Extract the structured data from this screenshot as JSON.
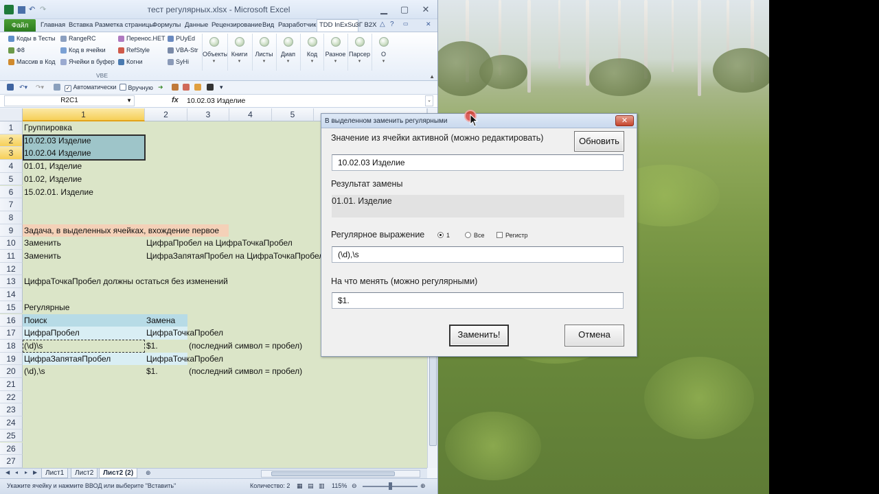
{
  "window": {
    "title": "тест регулярных.xlsx - Microsoft Excel"
  },
  "ribbon_tabs": [
    "Главная",
    "Вставка",
    "Разметка страницы",
    "Формулы",
    "Данные",
    "Рецензирование",
    "Вид",
    "Разработчик",
    "TDD InExSu",
    "ЗГ В2Х"
  ],
  "file_tab": "Файл",
  "ribbon": {
    "col1": [
      "Коды в Тесты",
      "Ф8",
      "Массив в Код"
    ],
    "col2": [
      "RangeRC",
      "Код в ячейки",
      "Ячейки в буфер"
    ],
    "col3": [
      "Перенос.НЕТ",
      "RefStyle",
      "Когни"
    ],
    "col4": [
      "PUyEd",
      "VBA-Str",
      "SyHi"
    ],
    "group_label": "VBE",
    "big_buttons": [
      "Объекты",
      "Книги",
      "Листы",
      "Диап",
      "Код",
      "Разное",
      "Парсер",
      "О"
    ]
  },
  "qat": {
    "auto": "Автоматически",
    "manual": "Вручную"
  },
  "formula_bar": {
    "name_box": "R2C1",
    "fx": "fx",
    "value": "10.02.03  Изделие"
  },
  "columns": [
    "1",
    "2",
    "3",
    "4",
    "5"
  ],
  "rows": [
    {
      "n": "1",
      "a": "Группировка",
      "b": "",
      "c": ""
    },
    {
      "n": "2",
      "a": "10.02.03  Изделие",
      "b": "",
      "c": ""
    },
    {
      "n": "3",
      "a": "10.02.04  Изделие",
      "b": "",
      "c": ""
    },
    {
      "n": "4",
      "a": "01.01, Изделие",
      "b": "",
      "c": ""
    },
    {
      "n": "5",
      "a": "01.02, Изделие",
      "b": "",
      "c": ""
    },
    {
      "n": "6",
      "a": "15.02.01. Изделие",
      "b": "",
      "c": ""
    },
    {
      "n": "7",
      "a": "",
      "b": "",
      "c": ""
    },
    {
      "n": "8",
      "a": "",
      "b": "",
      "c": ""
    },
    {
      "n": "9",
      "a": "Задача, в выделенных ячейках, вхождение первое",
      "b": "",
      "c": ""
    },
    {
      "n": "10",
      "a": "Заменить",
      "b": "ЦифраПробел на ЦифраТочкаПробел",
      "c": ""
    },
    {
      "n": "11",
      "a": "Заменить",
      "b": "ЦифраЗапятаяПробел на ЦифраТочкаПробел",
      "c": ""
    },
    {
      "n": "12",
      "a": "",
      "b": "",
      "c": ""
    },
    {
      "n": "13",
      "a": "ЦифраТочкаПробел должны остаться без изменений",
      "b": "",
      "c": ""
    },
    {
      "n": "14",
      "a": "",
      "b": "",
      "c": ""
    },
    {
      "n": "15",
      "a": "Регулярные",
      "b": "",
      "c": ""
    },
    {
      "n": "16",
      "a": "Поиск",
      "b": "Замена",
      "c": ""
    },
    {
      "n": "17",
      "a": "ЦифраПробел",
      "b": "ЦифраТочкаПробел",
      "c": ""
    },
    {
      "n": "18",
      "a": "(\\d)\\s",
      "b": "$1.",
      "c": "(последний символ = пробел)"
    },
    {
      "n": "19",
      "a": "ЦифраЗапятаяПробел",
      "b": "ЦифраТочкаПробел",
      "c": ""
    },
    {
      "n": "20",
      "a": "(\\d),\\s",
      "b": "$1.",
      "c": "(последний символ = пробел)"
    },
    {
      "n": "21",
      "a": "",
      "b": "",
      "c": ""
    },
    {
      "n": "22",
      "a": "",
      "b": "",
      "c": ""
    },
    {
      "n": "23",
      "a": "",
      "b": "",
      "c": ""
    },
    {
      "n": "24",
      "a": "",
      "b": "",
      "c": ""
    },
    {
      "n": "25",
      "a": "",
      "b": "",
      "c": ""
    },
    {
      "n": "26",
      "a": "",
      "b": "",
      "c": ""
    },
    {
      "n": "27",
      "a": "",
      "b": "",
      "c": ""
    }
  ],
  "sheets": [
    "Лист1",
    "Лист2",
    "Лист2 (2)"
  ],
  "status": {
    "message": "Укажите ячейку и нажмите ВВОД или выберите \"Вставить\"",
    "count": "Количество: 2",
    "zoom": "115%"
  },
  "dialog": {
    "title": "В выделенном заменить регулярными",
    "active_label": "Значение из ячейки активной (можно редактировать)",
    "refresh_button": "Обновить",
    "active_value": "10.02.03  Изделие",
    "result_label": "Результат замены",
    "result_value": "01.01. Изделие",
    "regex_label": "Регулярное выражение",
    "radio_one": "1",
    "radio_all": "Все",
    "checkbox_case": "Регистр",
    "regex_value": "(\\d),\\s",
    "replace_label": "На что менять (можно регулярными)",
    "replace_value": "$1.",
    "replace_button": "Заменить!",
    "cancel_button": "Отмена"
  },
  "colors": {
    "sheet_bg": "#dbe5c8",
    "task_highlight": "#f4d1b8",
    "header_blue": "#b7dbe6",
    "light_blue": "#d9eef4",
    "selection": "#9ec5c9"
  }
}
